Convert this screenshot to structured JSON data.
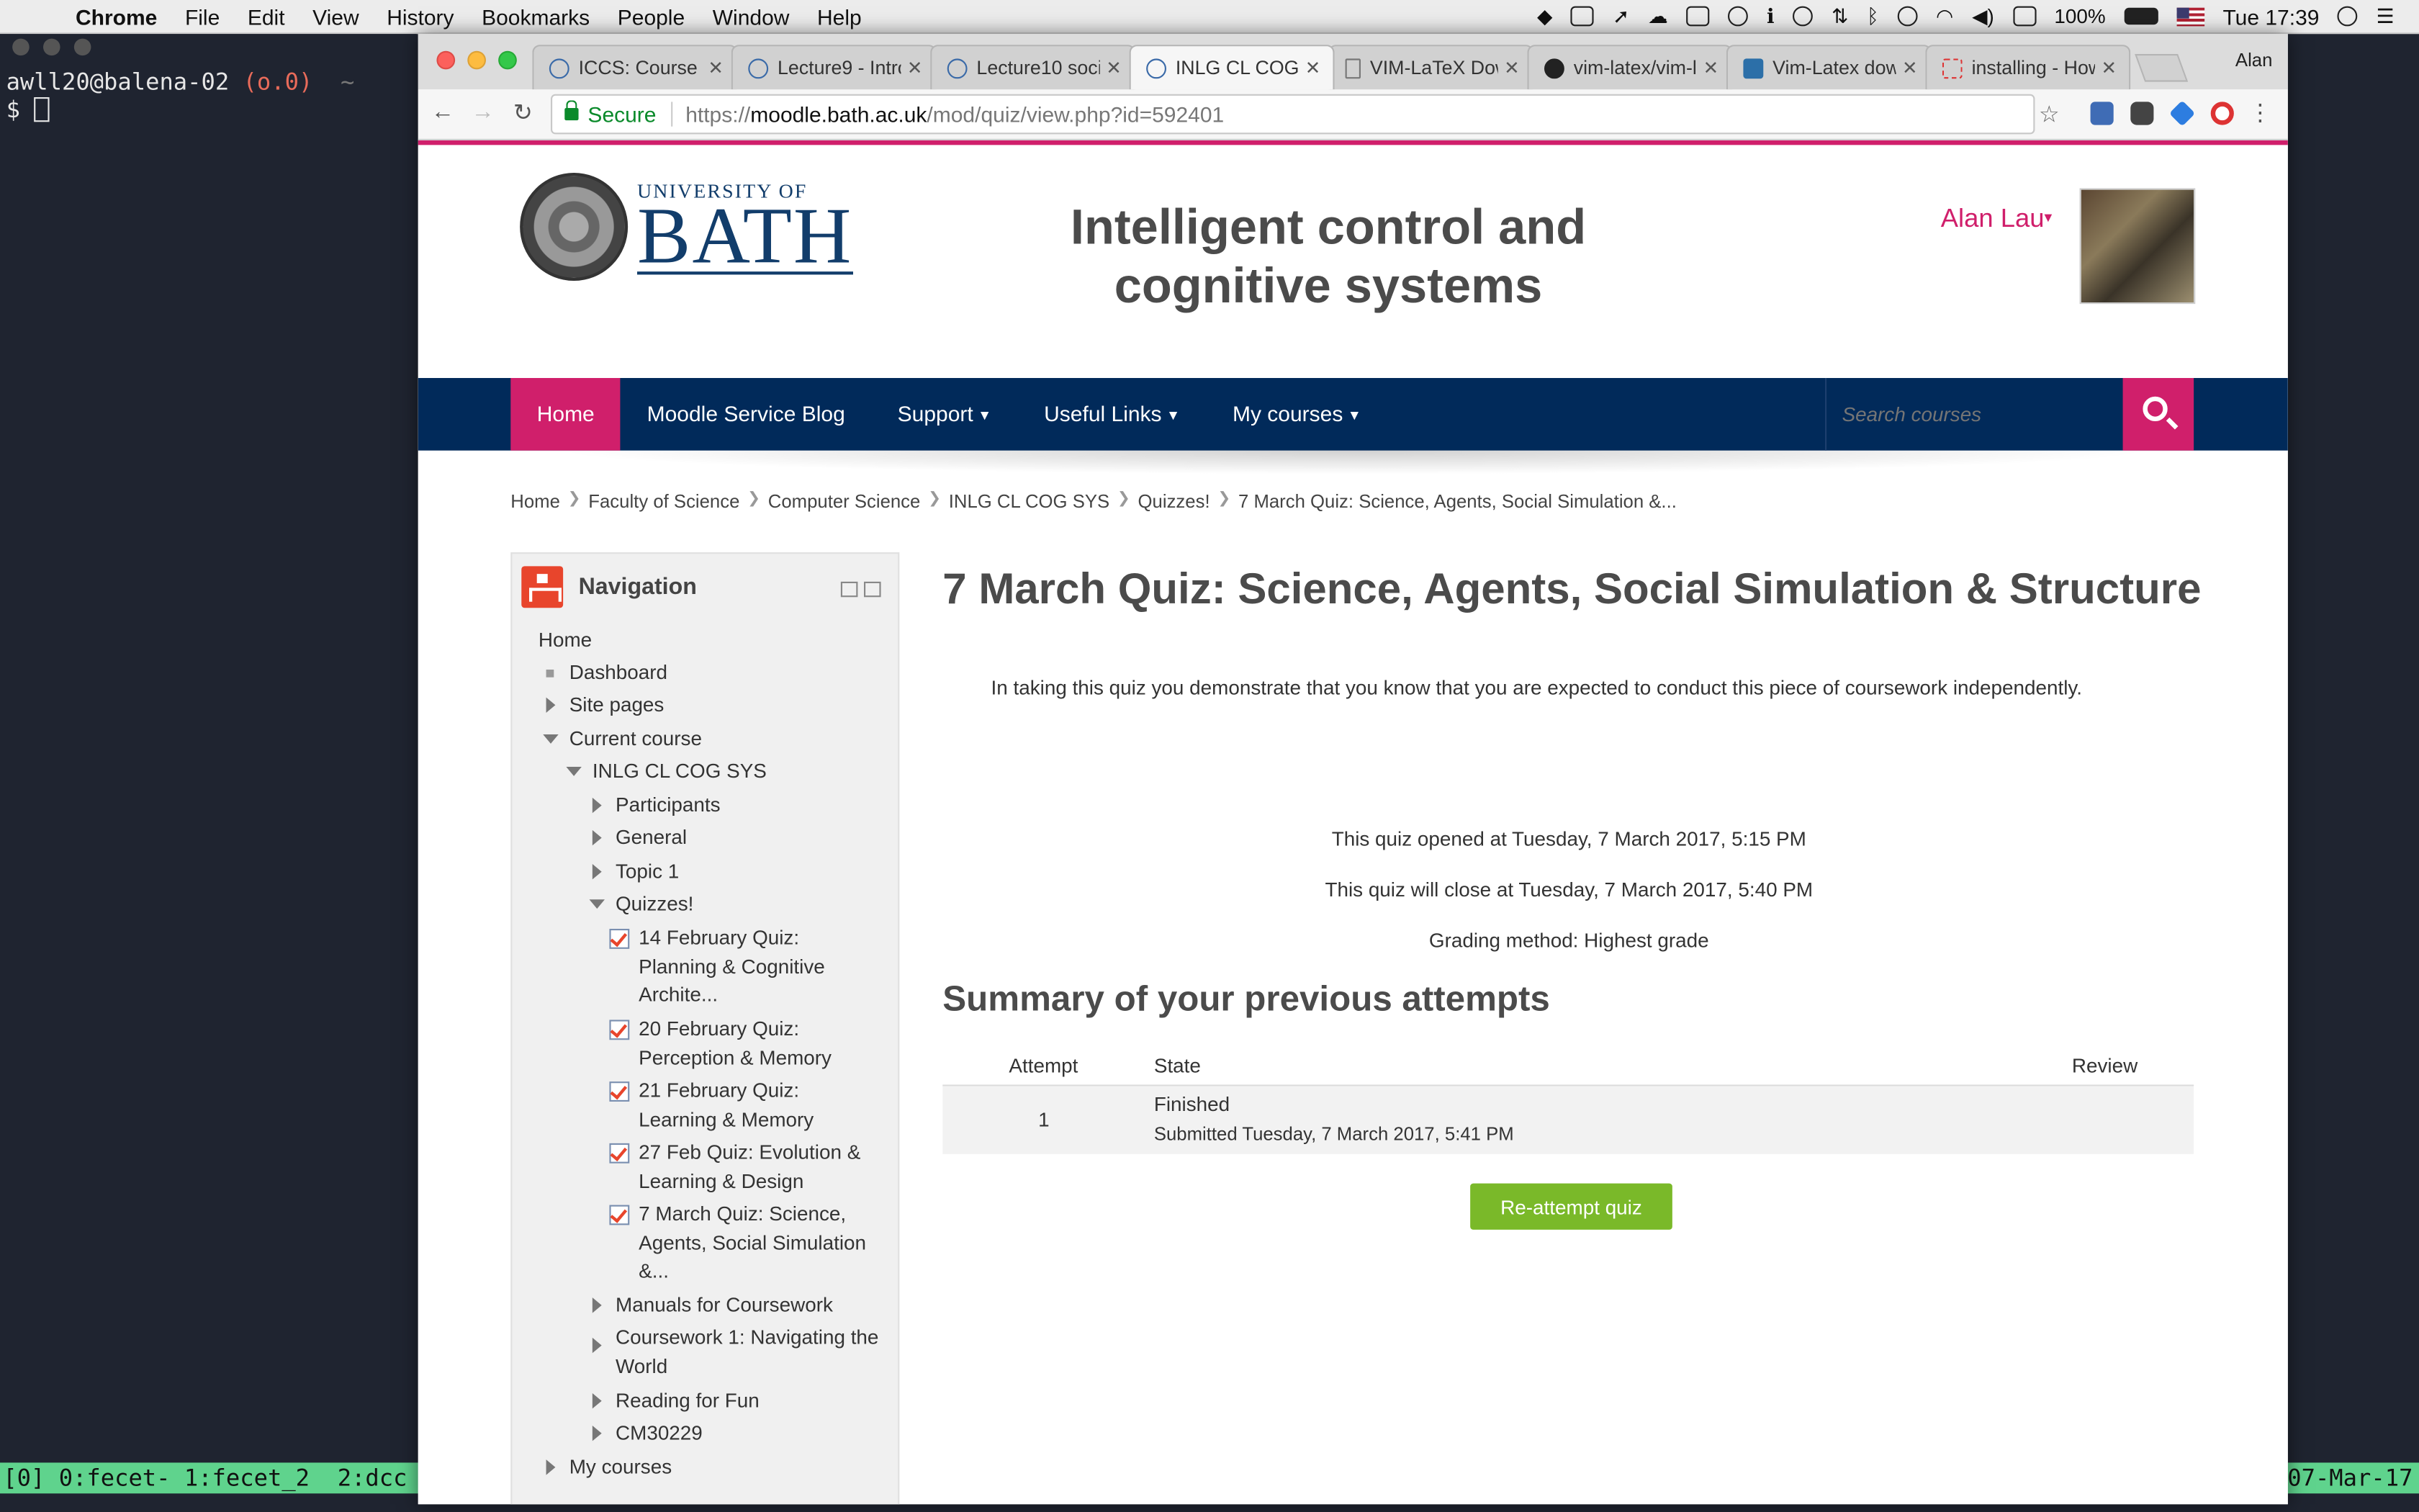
{
  "menubar": {
    "app": "Chrome",
    "items": [
      "File",
      "Edit",
      "View",
      "History",
      "Bookmarks",
      "People",
      "Window",
      "Help"
    ],
    "battery": "100%",
    "clock": "Tue 17:39"
  },
  "terminal": {
    "prompt_host": "awll20@balena-02",
    "prompt_status": "(o.0)",
    "prompt_tilde": "~",
    "prompt_symbol": "$"
  },
  "tmux": {
    "windows": "[0] 0:fecet- 1:fecet_2  2:dcc",
    "date": "07-Mar-17"
  },
  "browser": {
    "tabs": [
      {
        "title": "ICCS: Course S"
      },
      {
        "title": "Lecture9 - Intro"
      },
      {
        "title": "Lecture10 soci"
      },
      {
        "title": "INLG CL COG S"
      },
      {
        "title": "VIM-LaTeX Dow"
      },
      {
        "title": "vim-latex/vim-l"
      },
      {
        "title": "Vim-Latex dow"
      },
      {
        "title": "installing - How"
      }
    ],
    "profile": "Alan",
    "secure_label": "Secure",
    "url_scheme": "https://",
    "url_host": "moodle.bath.ac.uk",
    "url_path": "/mod/quiz/view.php?id=592401"
  },
  "header": {
    "logo_small": "UNIVERSITY OF",
    "logo_big": "BATH",
    "site_title_line1": "Intelligent control and",
    "site_title_line2": "cognitive systems",
    "user_name": "Alan Lau"
  },
  "navbar": {
    "items": [
      {
        "label": "Home"
      },
      {
        "label": "Moodle Service Blog"
      },
      {
        "label": "Support"
      },
      {
        "label": "Useful Links"
      },
      {
        "label": "My courses"
      }
    ],
    "search_placeholder": "Search courses"
  },
  "breadcrumb": [
    "Home",
    "Faculty of Science",
    "Computer Science",
    "INLG CL COG SYS",
    "Quizzes!",
    "7 March Quiz: Science, Agents, Social Simulation &..."
  ],
  "navigation_block": {
    "title": "Navigation",
    "tree": [
      {
        "label": "Home"
      },
      {
        "label": "Dashboard"
      },
      {
        "label": "Site pages"
      },
      {
        "label": "Current course"
      },
      {
        "label": "INLG CL COG SYS"
      },
      {
        "label": "Participants"
      },
      {
        "label": "General"
      },
      {
        "label": "Topic 1"
      },
      {
        "label": "Quizzes!"
      },
      {
        "label_l1": "14 February Quiz:",
        "label_l2": "Planning & Cognitive",
        "label_l3": "Archite..."
      },
      {
        "label_l1": "20 February Quiz:",
        "label_l2": "Perception & Memory"
      },
      {
        "label_l1": "21 February Quiz:",
        "label_l2": "Learning & Memory"
      },
      {
        "label_l1": "27 Feb Quiz: Evolution &",
        "label_l2": "Learning & Design"
      },
      {
        "label_l1": "7 March Quiz: Science,",
        "label_l2": "Agents, Social Simulation",
        "label_l3": "&..."
      },
      {
        "label": "Manuals for Coursework"
      },
      {
        "label_l1": "Coursework 1: Navigating the",
        "label_l2": "World"
      },
      {
        "label": "Reading for Fun"
      },
      {
        "label": "CM30229"
      },
      {
        "label": "My courses"
      }
    ]
  },
  "quiz": {
    "title": "7 March Quiz: Science, Agents, Social Simulation & Structure",
    "intro": "In taking this quiz you demonstrate that you know that you are expected to conduct this piece of coursework independently.",
    "opened": "This quiz opened at Tuesday, 7 March 2017, 5:15 PM",
    "closes": "This quiz will close at Tuesday, 7 March 2017, 5:40 PM",
    "grading": "Grading method: Highest grade",
    "summary_title": "Summary of your previous attempts",
    "table": {
      "headers": [
        "Attempt",
        "State",
        "Review"
      ],
      "rows": [
        {
          "attempt": "1",
          "state": "Finished",
          "submitted": "Submitted Tuesday, 7 March 2017, 5:41 PM"
        }
      ]
    },
    "reattempt_label": "Re-attempt quiz"
  }
}
